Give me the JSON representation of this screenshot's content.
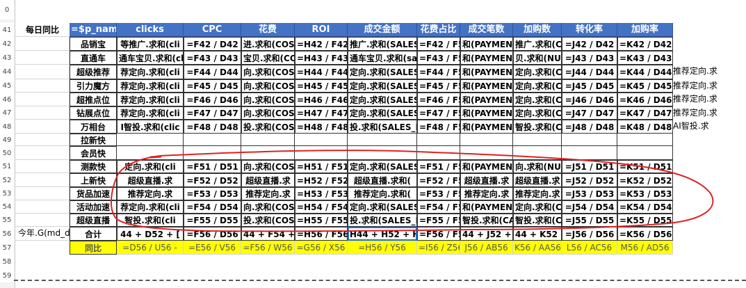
{
  "row_numbers": [
    "0",
    "41",
    "42",
    "43",
    "44",
    "45",
    "46",
    "47",
    "48",
    "49",
    "50",
    "51",
    "52",
    "53",
    "54",
    "55",
    "56",
    "57",
    "58",
    "59"
  ],
  "header": {
    "label": "每日同比",
    "columns": [
      "=$p_name",
      "clicks",
      "CPC",
      "花费",
      "ROI",
      "成交金额",
      "花费占比",
      "成交笔数",
      "加购数",
      "转化率",
      "加购率"
    ]
  },
  "rows": [
    {
      "name": "品销宝",
      "cells": [
        "等推广.求和(cli",
        "=F42 / D42",
        "进.求和(COST",
        "=H42 / F42",
        "推广.求和(SALES",
        "=F42 / F56",
        "和(PAYMEN",
        "推广.求和(CA",
        "=J42 / D42",
        "=K42 / D42"
      ],
      "side": ""
    },
    {
      "name": "直通车",
      "cells": [
        "通车宝贝.求和(cli",
        "=F43 / D43",
        "宝贝.求和(COST",
        "=H43 / F43",
        "通车宝贝.求和(sa",
        "=F43 / F56",
        "和(PAYMEN",
        "贝.求和(NUM",
        "=J43 / D43",
        "=K43 / D43"
      ],
      "side": ""
    },
    {
      "name": "超级推荐",
      "cells": [
        "荐定向.求和(cli",
        "=F44 / D44",
        "向.求和(COST",
        "=H44 / F44",
        "定向.求和(SALES",
        "=F44 / F56",
        "和(PAYMEN",
        "定向.求和(CA",
        "=J44 / D44",
        "=K44 / D44"
      ],
      "side": "推荐定向.求"
    },
    {
      "name": "引力魔方",
      "cells": [
        "荐定向.求和(cli",
        "=F45 / D45",
        "向.求和(COST",
        "=H45 / F45",
        "定向.求和(SALES_",
        "=F45 / F56",
        "和(PAYMEN",
        "定向.求和(CA",
        "=J45 / D45",
        "=K45 / D45"
      ],
      "side": "推荐定向.求"
    },
    {
      "name": "超推点位",
      "cells": [
        "荐定向.求和(cli",
        "=F46 / D46",
        "向.求和(COST",
        "=H46 / F46",
        "定向.求和(SALES_",
        "=F46 / F56",
        "和(PAYMEN",
        "定向.求和(CA",
        "=J46 / D46",
        "=K46 / D46"
      ],
      "side": "推荐定向.求"
    },
    {
      "name": "钻展点位",
      "cells": [
        "荐定向.求和(cli",
        "=F47 / D47",
        "向.求和(COST",
        "=H47 / F47",
        "定向.求和(SALES_",
        "=F47 / F56",
        "和(PAYMEN",
        "定向.求和(CA",
        "=J47 / D47",
        "=K47 / D47"
      ],
      "side": "推荐定向.求"
    },
    {
      "name": "万相台",
      "cells": [
        "I智投.求和(clic",
        "=F48 / D48",
        "投.求和(COST_",
        "=H48 / F48",
        "投.求和(SALES_R",
        "=F48 / F56",
        "和(PAYMENT",
        "智投.求和(CA",
        "=J48 / D48",
        "=K48 / D48"
      ],
      "side": "AI智投.求"
    },
    {
      "name": "拉新快",
      "cells": [
        "",
        "",
        "",
        "",
        "",
        "",
        "",
        "",
        "",
        ""
      ],
      "side": ""
    },
    {
      "name": "会员快",
      "cells": [
        "",
        "",
        "",
        "",
        "",
        "",
        "",
        "",
        "",
        ""
      ],
      "side": ""
    },
    {
      "name": "测款快",
      "cells": [
        "定向.求和(cli",
        "=F51 / D51",
        "向.求和(COST",
        "=H51 / F51",
        "定向.求和(SALES_",
        "=F51 / F56",
        "和(PAYMEN",
        "向.求和(NUM",
        "=J51 / D51",
        "=K51 / D51"
      ],
      "side": ""
    },
    {
      "name": "上新快",
      "cells": [
        "超级直播.求",
        "=F52 / D52",
        "超级直播.求",
        "=H52 / F52",
        "超级直播.求和(",
        "=F52 / F56",
        "超级直播.求",
        "超级直播.求",
        "=J52 / D52",
        "=K52 / D52"
      ],
      "side": ""
    },
    {
      "name": "货品加速",
      "cells": [
        "推荐定向.求",
        "=F53 / D53",
        "推荐定向.求",
        "=H53 / F53",
        "推荐定向.求和(",
        "=F53 / F56",
        "推荐定向.求",
        "推荐定向.求",
        "=J53 / D53",
        "=K53 / D53"
      ],
      "side": ""
    },
    {
      "name": "活动加速",
      "cells": [
        "荐定向.求和(cli",
        "=F54 / D54",
        "向.求和(COST",
        "=H54 / F54",
        "定向.求和(SALES",
        "=F54 / F56",
        "和(PAYMEN",
        "定向.求和(CA",
        "=J54 / D54",
        "=K54 / D54"
      ],
      "side": ""
    },
    {
      "name": "超级直播",
      "cells": [
        "智投.求和(cli",
        "=F55 / D55",
        "投.求和(COST",
        "=H55 / F55",
        "投.求和(SALES_R",
        "=F55 / F56",
        "智投.求和(CA",
        "智投.求和(CA",
        "=J55 / D55",
        "=K55 / D55"
      ],
      "side": ""
    },
    {
      "name": "合计",
      "cells": [
        "44 + D52 + [",
        "=F56 / D56",
        "44 + F54 + F",
        "=H56 / F56",
        "H44 + H52 + H",
        "=F56 / F56",
        "44 + J52 + J",
        "44 + K52 +",
        "=J56 / D56",
        "=K56 / D56"
      ],
      "side": ""
    },
    {
      "name": "同比",
      "cells": [
        "=D56 / U56 -",
        "=E56 / V56",
        "=F56 / W56",
        "=G56 / X56",
        "=H56 / Y56",
        "=I56 / Z56",
        "J56 / AB56",
        "K56 / AA56",
        "L56 / AC56",
        "M56 / AD56"
      ],
      "side": ""
    }
  ],
  "stray_text": "今年.G(md_d",
  "colors": {
    "header_bg": "#4472c4",
    "yellow": "#ffff00",
    "annotation": "#e02020",
    "selection": "#1f6fd0"
  }
}
